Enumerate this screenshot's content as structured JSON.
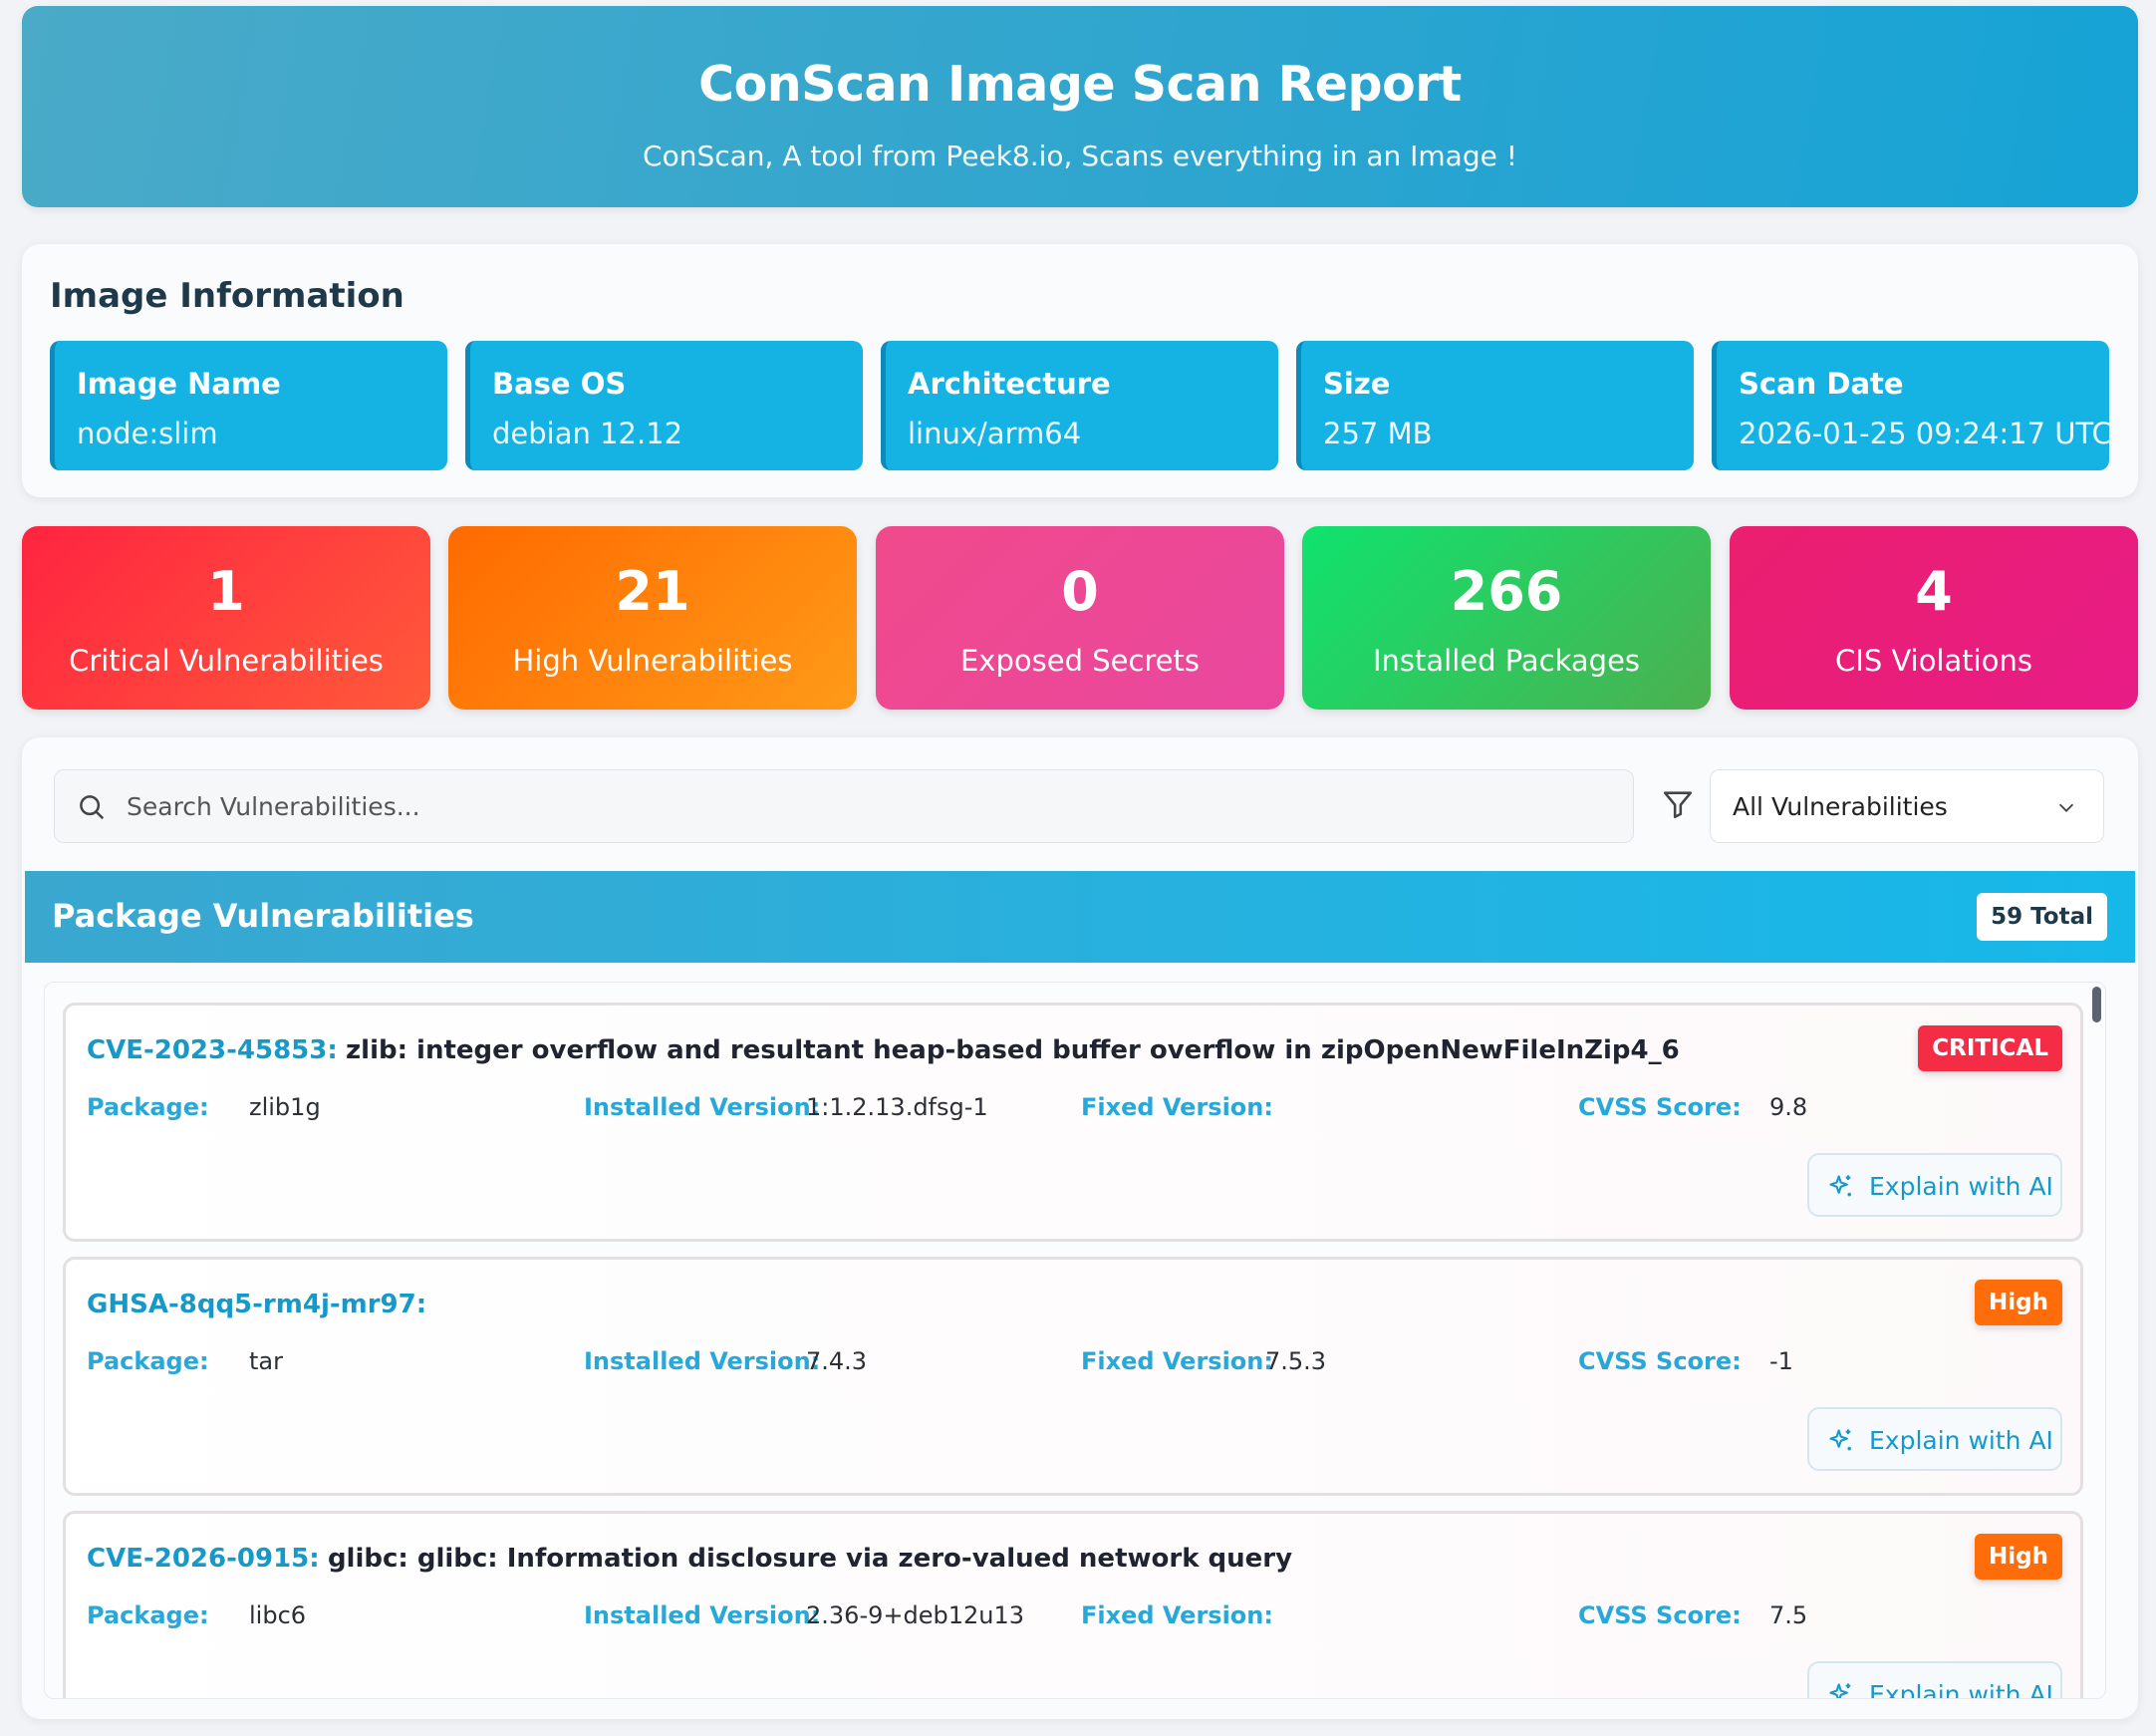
{
  "header": {
    "title": "ConScan Image Scan Report",
    "subtitle": "ConScan, A tool from Peek8.io, Scans everything in an Image !"
  },
  "image_info": {
    "heading": "Image Information",
    "tiles": [
      {
        "label": "Image Name",
        "value": "node:slim"
      },
      {
        "label": "Base OS",
        "value": "debian 12.12"
      },
      {
        "label": "Architecture",
        "value": "linux/arm64"
      },
      {
        "label": "Size",
        "value": "257 MB"
      },
      {
        "label": "Scan Date",
        "value": "2026-01-25 09:24:17 UTC"
      }
    ]
  },
  "stats": [
    {
      "value": "1",
      "label": "Critical Vulnerabilities",
      "color": "#ff2b43"
    },
    {
      "value": "21",
      "label": "High Vulnerabilities",
      "color": "#ff7a0a"
    },
    {
      "value": "0",
      "label": "Exposed Secrets",
      "color": "#ec4a94"
    },
    {
      "value": "266",
      "label": "Installed Packages",
      "color": "#1ed36a"
    },
    {
      "value": "4",
      "label": "CIS Violations",
      "color": "#e81c7e"
    }
  ],
  "search": {
    "placeholder": "Search Vulnerabilities...",
    "filter_selected": "All Vulnerabilities"
  },
  "vuln_list": {
    "title": "Package Vulnerabilities",
    "total": "59 Total",
    "field_labels": {
      "package": "Package:",
      "installed": "Installed Version:",
      "fixed": "Fixed Version:",
      "cvss": "CVSS Score:"
    },
    "explain_label": "Explain with AI",
    "items": [
      {
        "id": "CVE-2023-45853:",
        "description": "zlib: integer overflow and resultant heap-based buffer overflow in zipOpenNewFileInZip4_6",
        "severity": "CRITICAL",
        "package": "zlib1g",
        "installed_version": "1:1.2.13.dfsg-1",
        "fixed_version": "",
        "cvss": "9.8"
      },
      {
        "id": "GHSA-8qq5-rm4j-mr97:",
        "description": "",
        "severity": "High",
        "package": "tar",
        "installed_version": "7.4.3",
        "fixed_version": "7.5.3",
        "cvss": "-1"
      },
      {
        "id": "CVE-2026-0915:",
        "description": "glibc: glibc: Information disclosure via zero-valued network query",
        "severity": "High",
        "package": "libc6",
        "installed_version": "2.36-9+deb12u13",
        "fixed_version": "",
        "cvss": "7.5"
      }
    ]
  },
  "colors": {
    "accent": "#1699c9",
    "critical": "#f42c45",
    "high": "#ff6d0a"
  }
}
